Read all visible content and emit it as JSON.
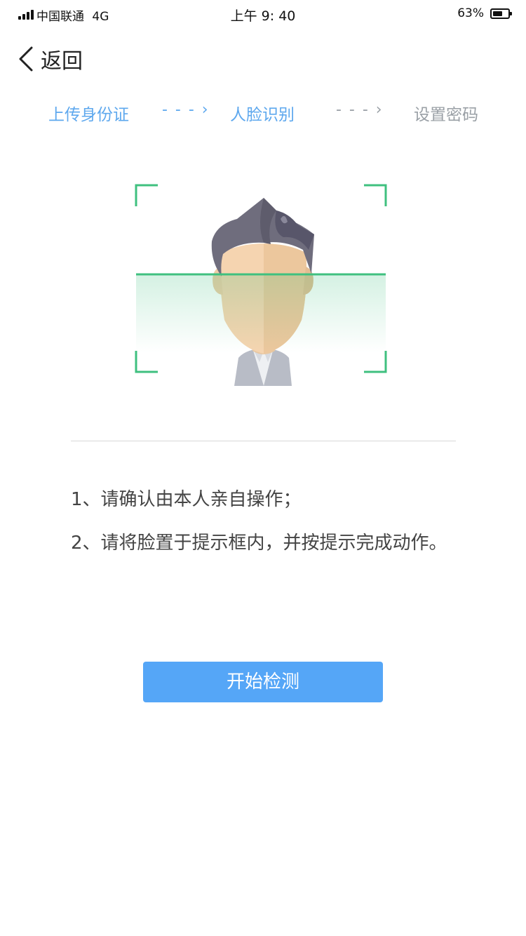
{
  "status_bar": {
    "carrier": "中国联通",
    "network": "4G",
    "time": "上午 9: 40",
    "battery_percent": "63%",
    "battery_level": 0.63
  },
  "nav": {
    "back_label": "返回",
    "back_icon": "chevron-left-icon"
  },
  "steps": {
    "items": [
      {
        "label": "上传身份证",
        "state": "done"
      },
      {
        "label": "人脸识别",
        "state": "current"
      },
      {
        "label": "设置密码",
        "state": "pending"
      }
    ],
    "arrow": "- - - ›"
  },
  "illustration": {
    "icon": "face-scan-illustration",
    "frame_color": "#3fc07f"
  },
  "tips": [
    "1、请确认由本人亲自操作；",
    "2、请将脸置于提示框内，并按提示完成动作。"
  ],
  "actions": {
    "start_label": "开始检测"
  },
  "colors": {
    "accent": "#55a6f7",
    "step_active": "#5ea8ee",
    "step_inactive": "#9aa0a6",
    "scan_line": "#3fc07f"
  }
}
